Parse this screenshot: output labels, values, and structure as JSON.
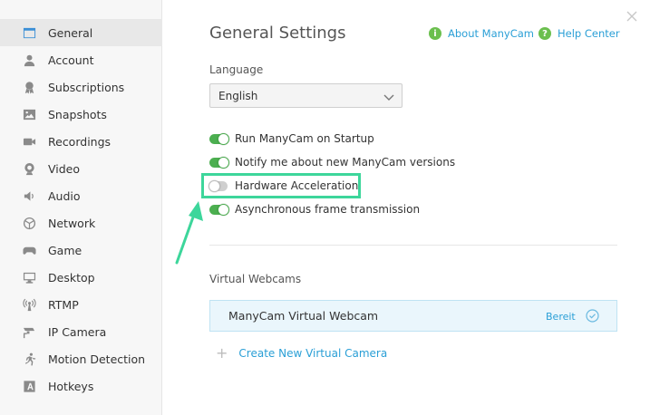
{
  "sidebar": {
    "items": [
      {
        "label": "General",
        "icon": "window-icon",
        "active": true
      },
      {
        "label": "Account",
        "icon": "user-icon"
      },
      {
        "label": "Subscriptions",
        "icon": "award-icon"
      },
      {
        "label": "Snapshots",
        "icon": "image-icon"
      },
      {
        "label": "Recordings",
        "icon": "video-camera-icon"
      },
      {
        "label": "Video",
        "icon": "webcam-icon"
      },
      {
        "label": "Audio",
        "icon": "speaker-icon"
      },
      {
        "label": "Network",
        "icon": "network-icon"
      },
      {
        "label": "Game",
        "icon": "gamepad-icon"
      },
      {
        "label": "Desktop",
        "icon": "monitor-icon"
      },
      {
        "label": "RTMP",
        "icon": "broadcast-icon"
      },
      {
        "label": "IP Camera",
        "icon": "security-camera-icon"
      },
      {
        "label": "Motion Detection",
        "icon": "running-icon"
      },
      {
        "label": "Hotkeys",
        "icon": "keyboard-key-icon"
      }
    ]
  },
  "header": {
    "title": "General Settings",
    "about_label": "About ManyCam",
    "help_label": "Help Center",
    "about_icon_glyph": "i",
    "help_icon_glyph": "?"
  },
  "language": {
    "label": "Language",
    "selected": "English"
  },
  "toggles": [
    {
      "label": "Run ManyCam on Startup",
      "on": true
    },
    {
      "label": "Notify me about new ManyCam versions",
      "on": true
    },
    {
      "label": "Hardware Acceleration",
      "on": false
    },
    {
      "label": "Asynchronous frame transmission",
      "on": true
    }
  ],
  "virtual_webcams": {
    "label": "Virtual Webcams",
    "items": [
      {
        "name": "ManyCam Virtual Webcam",
        "status": "Bereit"
      }
    ],
    "create_label": "Create New Virtual Camera"
  },
  "colors": {
    "accent": "#2a9fd6",
    "toggle_on": "#4caf50",
    "highlight": "#3dd69b"
  }
}
